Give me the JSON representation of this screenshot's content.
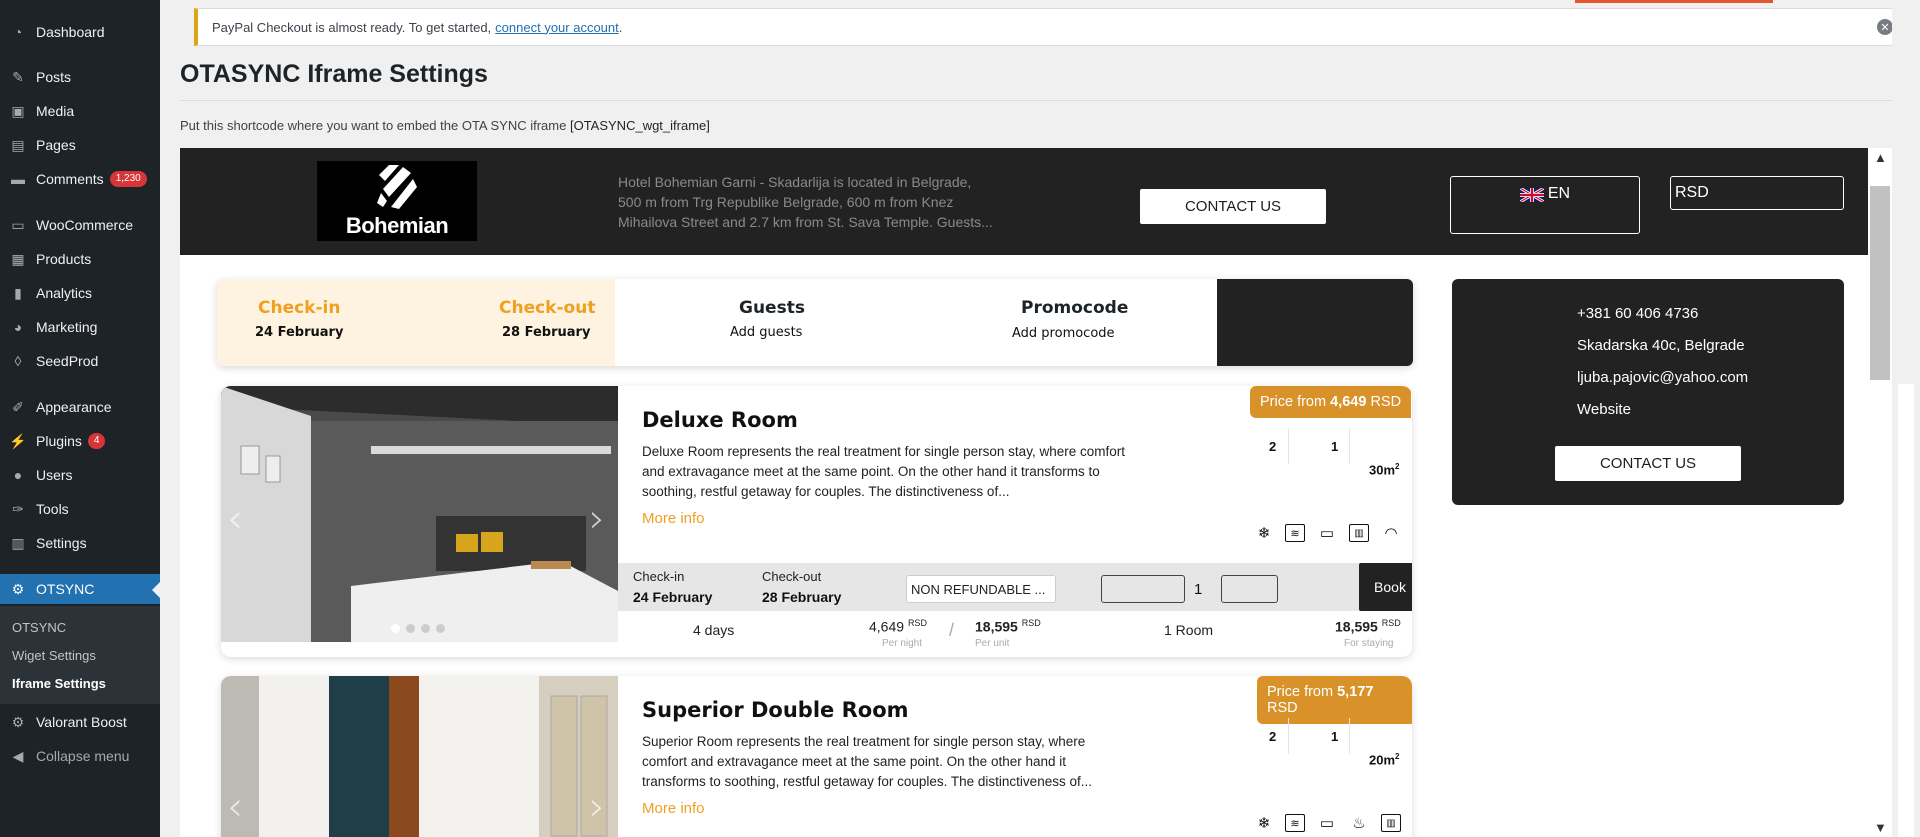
{
  "sidebar": {
    "items": [
      {
        "label": "Dashboard",
        "icon": "dashboard-icon"
      },
      {
        "label": "Posts",
        "icon": "pin-icon"
      },
      {
        "label": "Media",
        "icon": "media-icon"
      },
      {
        "label": "Pages",
        "icon": "pages-icon"
      },
      {
        "label": "Comments",
        "icon": "comments-icon",
        "badge": "1,230"
      },
      {
        "label": "WooCommerce",
        "icon": "woo-icon"
      },
      {
        "label": "Products",
        "icon": "products-icon"
      },
      {
        "label": "Analytics",
        "icon": "analytics-icon"
      },
      {
        "label": "Marketing",
        "icon": "marketing-icon"
      },
      {
        "label": "SeedProd",
        "icon": "seedprod-icon"
      },
      {
        "label": "Appearance",
        "icon": "brush-icon"
      },
      {
        "label": "Plugins",
        "icon": "plugin-icon",
        "badge": "4"
      },
      {
        "label": "Users",
        "icon": "users-icon"
      },
      {
        "label": "Tools",
        "icon": "wrench-icon"
      },
      {
        "label": "Settings",
        "icon": "settings-icon"
      },
      {
        "label": "OTSYNC",
        "icon": "gear-icon"
      }
    ],
    "submenu": [
      "OTSYNC",
      "Wiget Settings",
      "Iframe Settings"
    ],
    "extra": [
      {
        "label": "Valorant Boost",
        "icon": "gear-icon"
      },
      {
        "label": "Collapse menu",
        "icon": "collapse-icon"
      }
    ]
  },
  "notice": {
    "text": "PayPal Checkout is almost ready. To get started,",
    "link": "connect your account",
    "tail": "."
  },
  "page": {
    "title": "OTASYNC Iframe Settings",
    "shortcode_text": "Put this shortcode where you want to embed the OTA SYNC iframe",
    "shortcode": "[OTASYNC_wgt_iframe]"
  },
  "hotel": {
    "brand": "Bohemian",
    "description": "Hotel Bohemian Garni - Skadarlija is located in Belgrade, 500 m from Trg Republike Belgrade, 600 m from Knez Mihailova Street and 2.7 km from St. Sava Temple. Guests...",
    "contact_button": "CONTACT US",
    "language": "EN",
    "currency": "RSD"
  },
  "search": {
    "checkin_label": "Check-in",
    "checkin_value": "24 February",
    "checkout_label": "Check-out",
    "checkout_value": "28 February",
    "guests_label": "Guests",
    "guests_value": "Add guests",
    "promo_label": "Promocode",
    "promo_value": "Add promocode"
  },
  "contact": {
    "phone": "+381 60 406 4736",
    "address": "Skadarska 40c, Belgrade",
    "email": "ljuba.pajovic@yahoo.com",
    "website": "Website",
    "button": "CONTACT US"
  },
  "rooms": [
    {
      "title": "Deluxe Room",
      "description": "Deluxe Room represents the real treatment for single person stay, where comfort and extravagance meet at the same point. On the other hand it transforms to soothing, restful getaway for couples. The distinctiveness of...",
      "more": "More info",
      "price_prefix": "Price from",
      "price": "4,649",
      "price_cur": "RSD",
      "adults": "2",
      "children": "1",
      "size": "30m",
      "size_sup": "2",
      "checkin_label": "Check-in",
      "checkin": "24 February",
      "checkout_label": "Check-out",
      "checkout": "28 February",
      "rate": "NON REFUNDABLE ...",
      "qty": "1",
      "book": "Book",
      "days": "4 days",
      "per_night": "4,649",
      "per_night_cur": "RSD",
      "per_night_label": "Per night",
      "per_unit": "18,595",
      "per_unit_cur": "RSD",
      "per_unit_label": "Per unit",
      "rooms": "1 Room",
      "total": "18,595",
      "total_cur": "RSD",
      "total_label": "For staying",
      "amenities": [
        "snowflake-icon",
        "heater-icon",
        "tv-icon",
        "fridge-icon",
        "wifi-icon"
      ]
    },
    {
      "title": "Superior Double Room",
      "description": "Superior Room represents the real treatment for single person stay, where comfort and extravagance meet at the same point. On the other hand it transforms to soothing, restful getaway for couples. The distinctiveness of...",
      "more": "More info",
      "price_prefix": "Price from",
      "price": "5,177",
      "price_cur": "RSD",
      "adults": "2",
      "children": "1",
      "size": "20m",
      "size_sup": "2",
      "amenities": [
        "snowflake-icon",
        "heater-icon",
        "tv-icon",
        "kettle-icon",
        "fridge-icon"
      ]
    }
  ],
  "colors": {
    "accent": "#f0a020",
    "price": "#d9912a",
    "wp_blue": "#2271b1",
    "dark": "#222222"
  }
}
